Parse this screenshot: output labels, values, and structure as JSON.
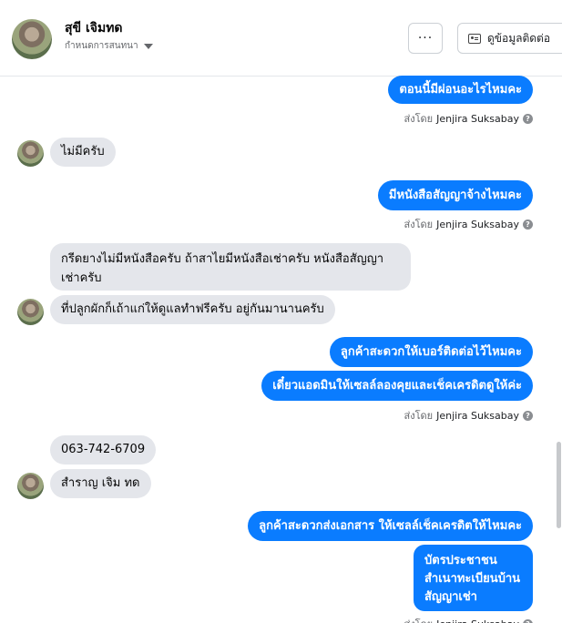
{
  "header": {
    "name": "สุขี เจิมทด",
    "status": "กำหนดการสนทนา",
    "more_label": "···",
    "contact_label": "ดูข้อมูลติดต่อ"
  },
  "messages": [
    {
      "text": "ตอนนี้มีผ่อนอะไรไหมคะ"
    },
    {
      "text": "ไม่มีครับ"
    },
    {
      "text": "มีหนังสือสัญญาจ้างไหมคะ"
    },
    {
      "lines": [
        "กรีดยางไม่มีหนังสือครับ ถ้าสาไยมีหนังสือเช่าครับ หนังสือสัญญา",
        "เช่าครับ"
      ]
    },
    {
      "text": "ที่ปลูกผักก็เถ้าแก่ให้ดูแลทำฟรีครับ อยู่กันมานานครับ"
    },
    {
      "text": "ลูกค้าสะดวกให้เบอร์ติดต่อไว้ไหมคะ"
    },
    {
      "text": "เดี๋ยวแอดมินให้เซลล์ลองคุยและเช็คเครดิตดูให้ค่ะ"
    },
    {
      "text": "063-742-6709"
    },
    {
      "text": "สำราญ เจิม ทด"
    },
    {
      "text": "ลูกค้าสะดวกส่งเอกสาร ให้เซลล์เช็คเครดิตให้ไหมคะ"
    },
    {
      "lines": [
        "บัตรประชาชน",
        "สำเนาทะเบียนบ้าน",
        "สัญญาเช่า"
      ]
    }
  ],
  "sent_by": {
    "prefix": "ส่งโดย",
    "agent": "Jenjira Suksabay",
    "help": "?"
  },
  "colors": {
    "outgoing_bubble": "#0a7cff",
    "incoming_bubble": "#e4e6eb"
  }
}
